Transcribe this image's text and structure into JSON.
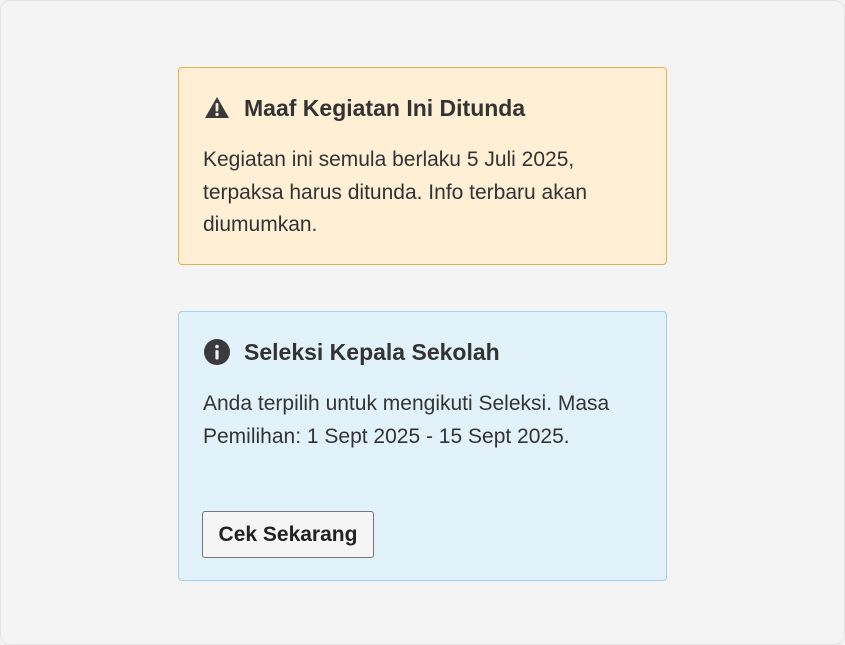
{
  "colors": {
    "page_background": "#f4f4f4",
    "warning_background": "#ffefd5",
    "warning_border": "#e8b04b",
    "info_background": "#e2f2fb",
    "info_border": "#9ed4ef",
    "icon_color": "#3a3a3a"
  },
  "alerts": [
    {
      "variant": "warning",
      "icon": "warning-triangle-icon",
      "title": "Maaf Kegiatan Ini Ditunda",
      "message": "Kegiatan ini semula berlaku 5 Juli 2025, terpaksa harus ditunda. Info terbaru akan diumumkan."
    },
    {
      "variant": "info",
      "icon": "info-circle-icon",
      "title": "Seleksi Kepala Sekolah",
      "message": "Anda terpilih untuk mengikuti Seleksi. Masa Pemilihan: 1 Sept 2025 - 15 Sept 2025.",
      "button_label": "Cek Sekarang"
    }
  ]
}
